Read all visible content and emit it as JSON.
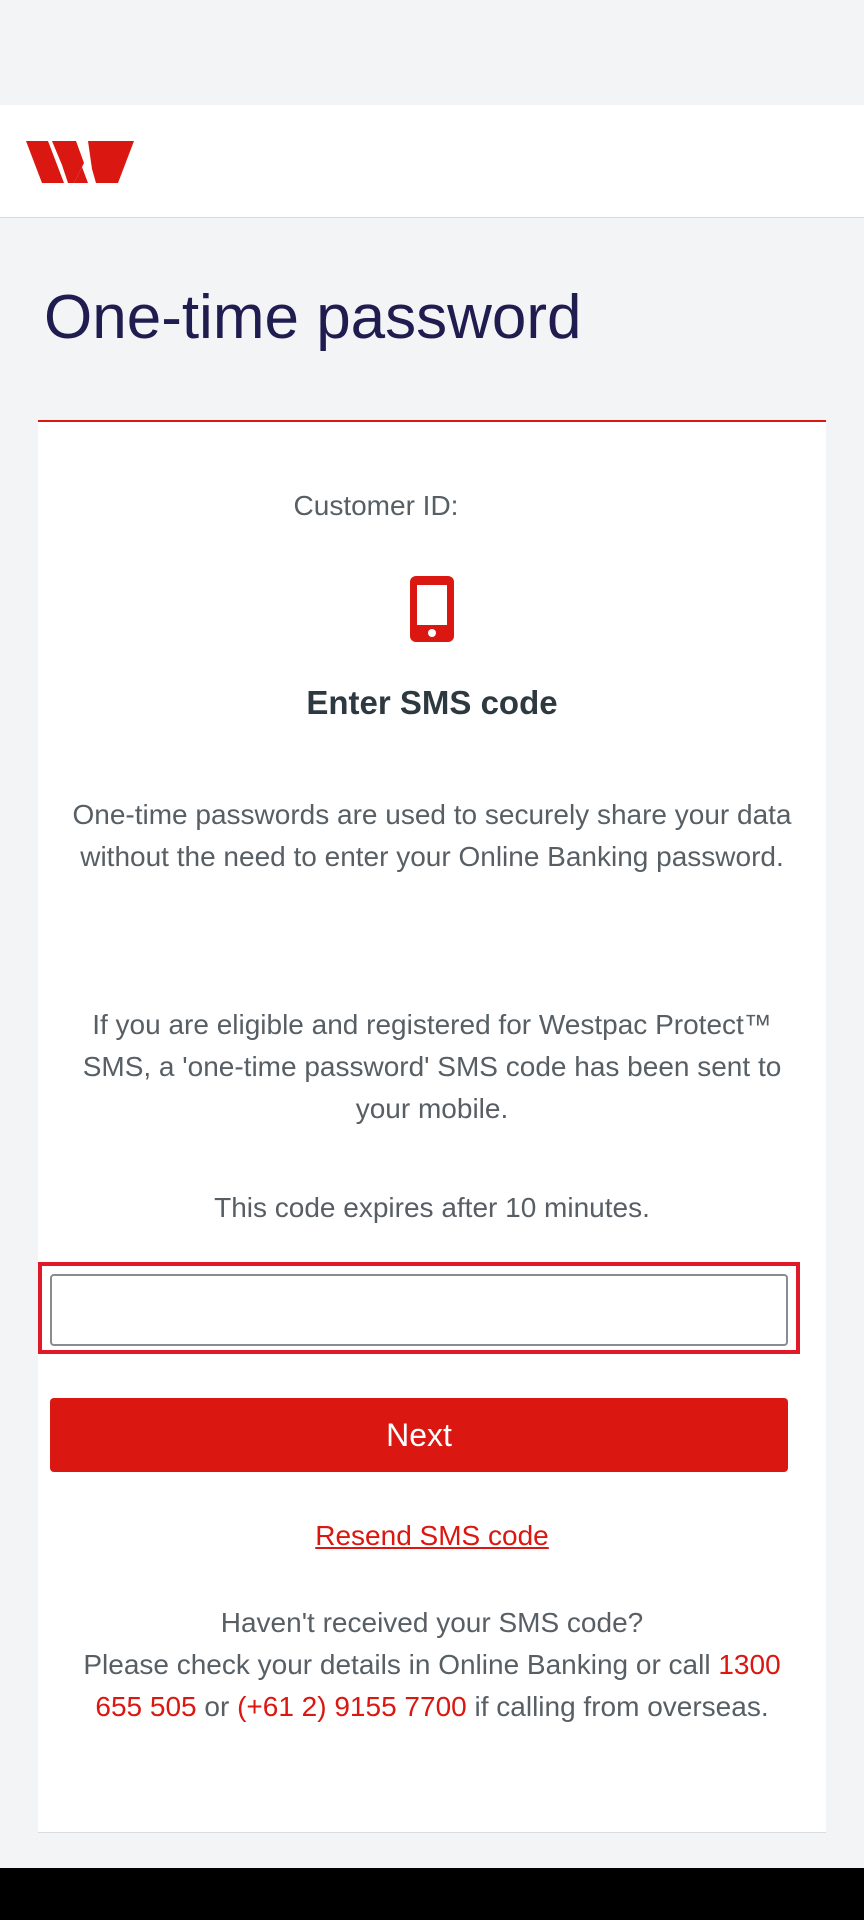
{
  "header": {
    "logo_alt": "Westpac"
  },
  "page": {
    "title": "One-time password"
  },
  "card": {
    "customer_id_label": "Customer ID:",
    "sms_heading": "Enter SMS code",
    "description1": "One-time passwords are used to securely share your data without the need to enter your Online Banking password.",
    "description2": "If you are eligible and registered for Westpac Protect™ SMS, a 'one-time password' SMS code has been sent to your mobile.",
    "expiry": "This code expires after 10 minutes.",
    "code_input": {
      "value": "",
      "placeholder": ""
    },
    "next_label": "Next",
    "resend_label": "Resend SMS code",
    "help": {
      "question": "Haven't received your SMS code?",
      "line_prefix": "Please check your details in Online Banking or call ",
      "phone_local": "1300 655 505",
      "connector": " or ",
      "phone_overseas": "(+61 2) 9155 7700",
      "suffix": " if calling from overseas."
    }
  },
  "colors": {
    "brand_red": "#da1710",
    "title_navy": "#1f1c4f",
    "text_gray": "#575f65"
  },
  "icons": {
    "logo": "westpac-w-logo",
    "device": "smartphone-icon"
  }
}
